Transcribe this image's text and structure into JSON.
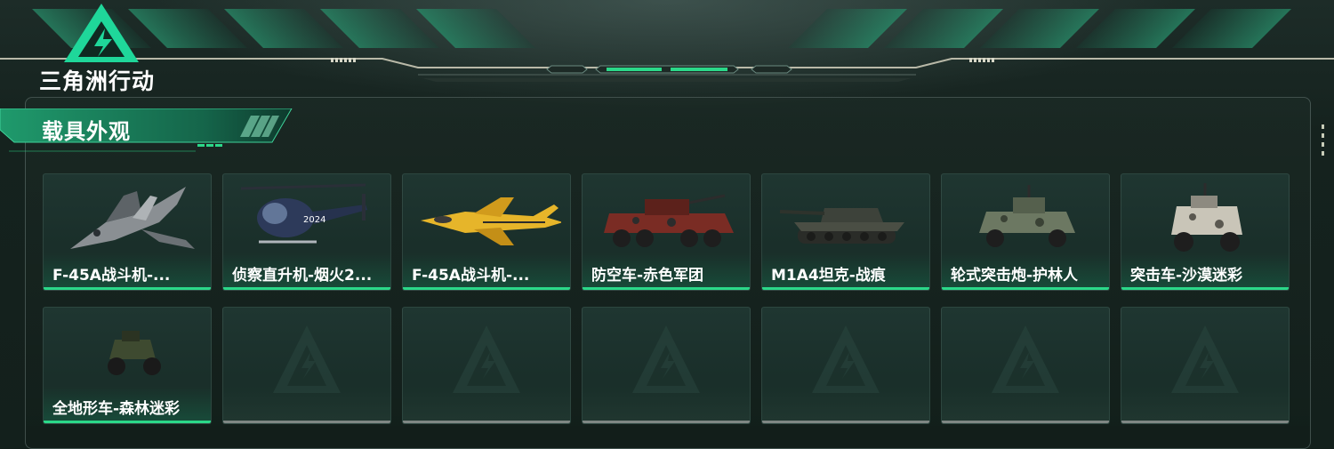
{
  "app": {
    "logo_text": "三角洲行动"
  },
  "section": {
    "title": "载具外观"
  },
  "colors": {
    "accent": "#2bd889",
    "empty_bar": "#7f8784",
    "card_bg": "#1f3631"
  },
  "vehicles": [
    {
      "label": "F-45A战斗机-...",
      "icon": "fighter-jet-camo"
    },
    {
      "label": "侦察直升机-烟火2...",
      "icon": "scout-helicopter"
    },
    {
      "label": "F-45A战斗机-...",
      "icon": "fighter-jet-yellow"
    },
    {
      "label": "防空车-赤色军团",
      "icon": "aa-vehicle-red"
    },
    {
      "label": "M1A4坦克-战痕",
      "icon": "tank"
    },
    {
      "label": "轮式突击炮-护林人",
      "icon": "wheeled-assault-gun"
    },
    {
      "label": "突击车-沙漠迷彩",
      "icon": "assault-vehicle"
    },
    {
      "label": "全地形车-森林迷彩",
      "icon": "atv"
    }
  ],
  "empty_slots": 6
}
